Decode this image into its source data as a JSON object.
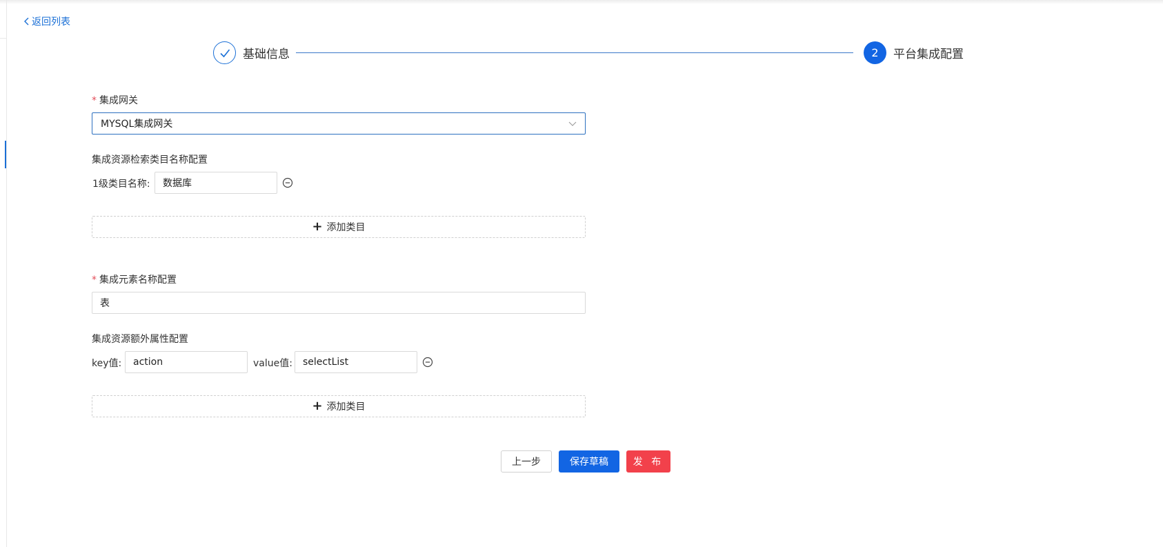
{
  "nav": {
    "back_label": "返回列表"
  },
  "steps": [
    {
      "title": "基础信息",
      "status": "done"
    },
    {
      "number": "2",
      "title": "平台集成配置",
      "status": "active"
    }
  ],
  "form": {
    "gateway": {
      "label": "集成网关",
      "required": "*",
      "value": "MYSQL集成网关"
    },
    "category_config": {
      "label": "集成资源检索类目名称配置",
      "items": [
        {
          "label": "1级类目名称:",
          "value": "数据库"
        }
      ],
      "add_label": "添加类目"
    },
    "element_name": {
      "label": "集成元素名称配置",
      "required": "*",
      "value": "表"
    },
    "extra_attrs": {
      "label": "集成资源额外属性配置",
      "items": [
        {
          "key_label": "key值:",
          "key": "action",
          "value_label": "value值:",
          "value": "selectList"
        }
      ],
      "add_label": "添加类目"
    }
  },
  "actions": {
    "prev": "上一步",
    "save_draft": "保存草稿",
    "publish": "发 布"
  },
  "colors": {
    "primary": "#1265e3",
    "danger": "#f2414b",
    "required": "#e34d59"
  }
}
